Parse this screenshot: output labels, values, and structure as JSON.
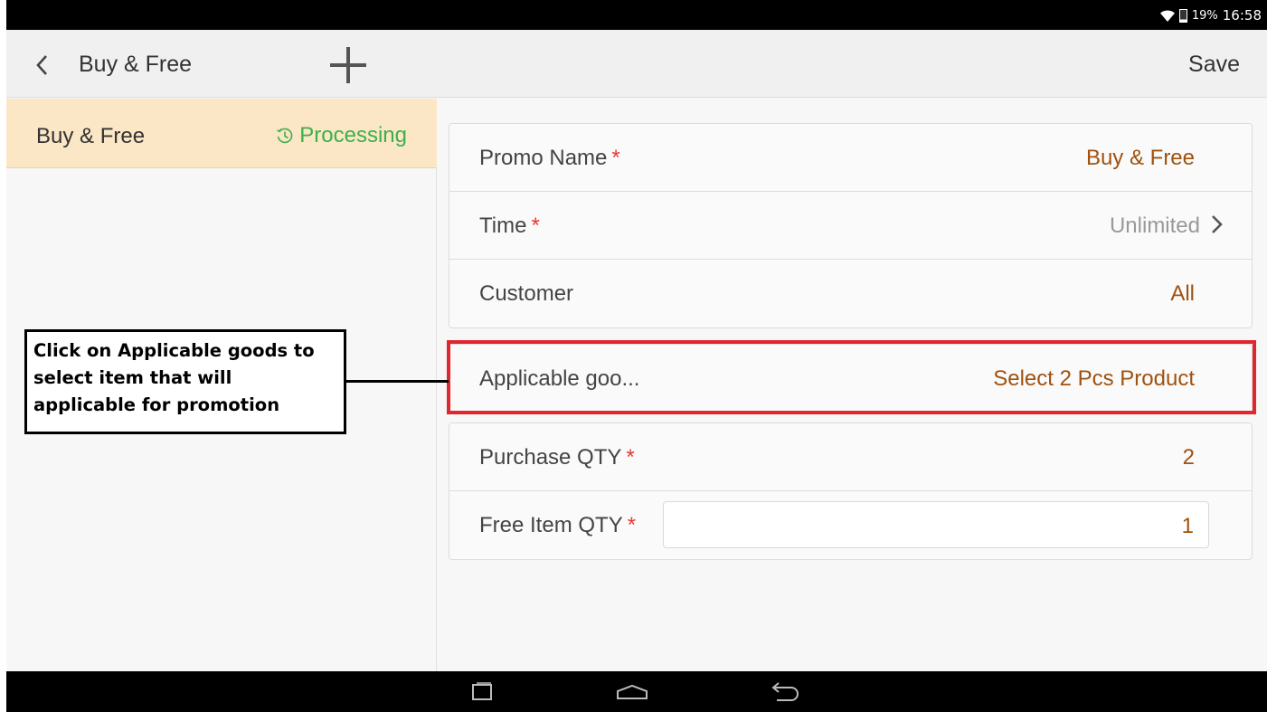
{
  "status_bar": {
    "battery_pct": "19%",
    "time": "16:58"
  },
  "action_bar": {
    "title": "Buy & Free",
    "save_label": "Save"
  },
  "promo_list": [
    {
      "name": "Buy & Free",
      "status": "Processing"
    }
  ],
  "form": {
    "promo_name": {
      "label": "Promo Name",
      "required": "*",
      "value": "Buy & Free"
    },
    "time": {
      "label": "Time",
      "required": "*",
      "value": "Unlimited"
    },
    "customer": {
      "label": "Customer",
      "value": "All"
    },
    "applicable_goods": {
      "label": "Applicable goo...",
      "value": "Select 2 Pcs Product"
    },
    "purchase_qty": {
      "label": "Purchase QTY",
      "required": "*",
      "value": "2"
    },
    "free_item_qty": {
      "label": "Free Item QTY",
      "required": "*",
      "value": "1"
    }
  },
  "annotation": {
    "line1": "Click on Applicable goods to",
    "line2": "select item that will",
    "line3": "applicable for promotion"
  },
  "colors": {
    "accent_value": "#a0520f",
    "status_green": "#3db04a",
    "required": "#e53935",
    "highlight": "#e0262e",
    "selected_row": "#fbe6c6"
  }
}
